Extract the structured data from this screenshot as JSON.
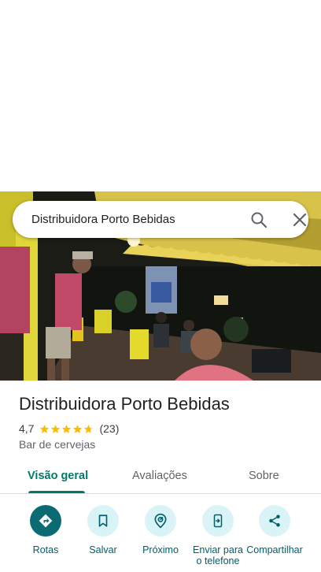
{
  "search": {
    "query": "Distribuidora Porto Bebidas",
    "search_icon": "search-icon",
    "close_icon": "close-icon"
  },
  "photo": {
    "description_icon": "place-photo"
  },
  "place": {
    "title": "Distribuidora Porto Bebidas",
    "rating": "4,7",
    "stars": 4.7,
    "reviews": "(23)",
    "category": "Bar de cervejas"
  },
  "tabs": [
    {
      "label": "Visão geral",
      "active": true
    },
    {
      "label": "Avaliações",
      "active": false
    },
    {
      "label": "Sobre",
      "active": false
    }
  ],
  "actions": [
    {
      "label": "Rotas",
      "icon": "directions-icon"
    },
    {
      "label": "Salvar",
      "icon": "bookmark-icon"
    },
    {
      "label": "Próximo",
      "icon": "nearby-icon"
    },
    {
      "label": "Enviar para o telefone",
      "icon": "send-to-phone-icon"
    },
    {
      "label": "Compartilhar",
      "icon": "share-icon"
    }
  ],
  "colors": {
    "accent": "#00796b",
    "action_bg": "#d9f3f7",
    "primary_action_bg": "#0b6b73",
    "star": "#fbbc04"
  }
}
